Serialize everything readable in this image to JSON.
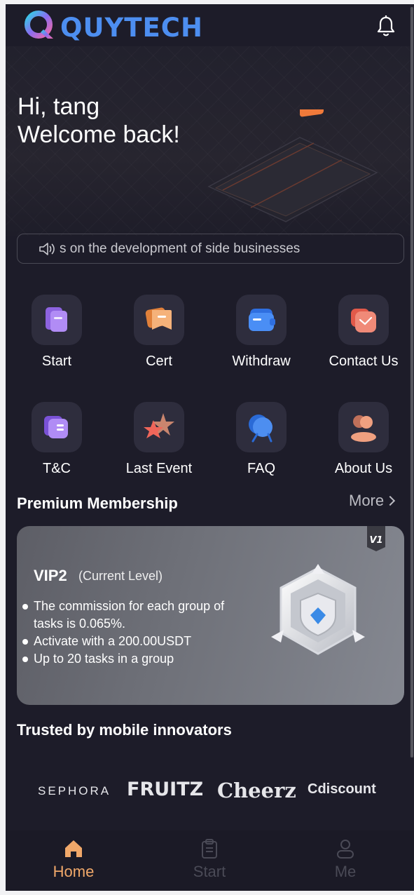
{
  "header": {
    "brand": "QUYTECH"
  },
  "hero": {
    "greeting_line1": "Hi, tang",
    "greeting_line2": "Welcome back!"
  },
  "notice": {
    "text": "s on the development of side businesses"
  },
  "menu": [
    {
      "label": "Start",
      "icon": "document-icon"
    },
    {
      "label": "Cert",
      "icon": "cert-icon"
    },
    {
      "label": "Withdraw",
      "icon": "wallet-icon"
    },
    {
      "label": "Contact Us",
      "icon": "mail-icon"
    },
    {
      "label": "T&C",
      "icon": "terms-icon"
    },
    {
      "label": "Last Event",
      "icon": "star-icon"
    },
    {
      "label": "FAQ",
      "icon": "faq-icon"
    },
    {
      "label": "About Us",
      "icon": "people-icon"
    }
  ],
  "premium": {
    "title": "Premium Membership",
    "more_label": "More",
    "badge": "V1",
    "level": "VIP2",
    "level_note": "(Current Level)",
    "benefits": [
      "The commission for each group of tasks is 0.065%.",
      "Activate with a 200.00USDT",
      "Up to 20 tasks in a group"
    ]
  },
  "trusted": {
    "title": "Trusted by mobile innovators",
    "brands": [
      "SEPHORA",
      "FRUITZ",
      "Cheerz",
      "Cdiscount"
    ]
  },
  "tabbar": [
    {
      "label": "Home",
      "icon": "home-icon",
      "active": true
    },
    {
      "label": "Start",
      "icon": "clipboard-icon",
      "active": false
    },
    {
      "label": "Me",
      "icon": "user-icon",
      "active": false
    }
  ],
  "colors": {
    "accent": "#f0a86a",
    "background": "#1d1c29",
    "inactive": "#4a4a56"
  }
}
